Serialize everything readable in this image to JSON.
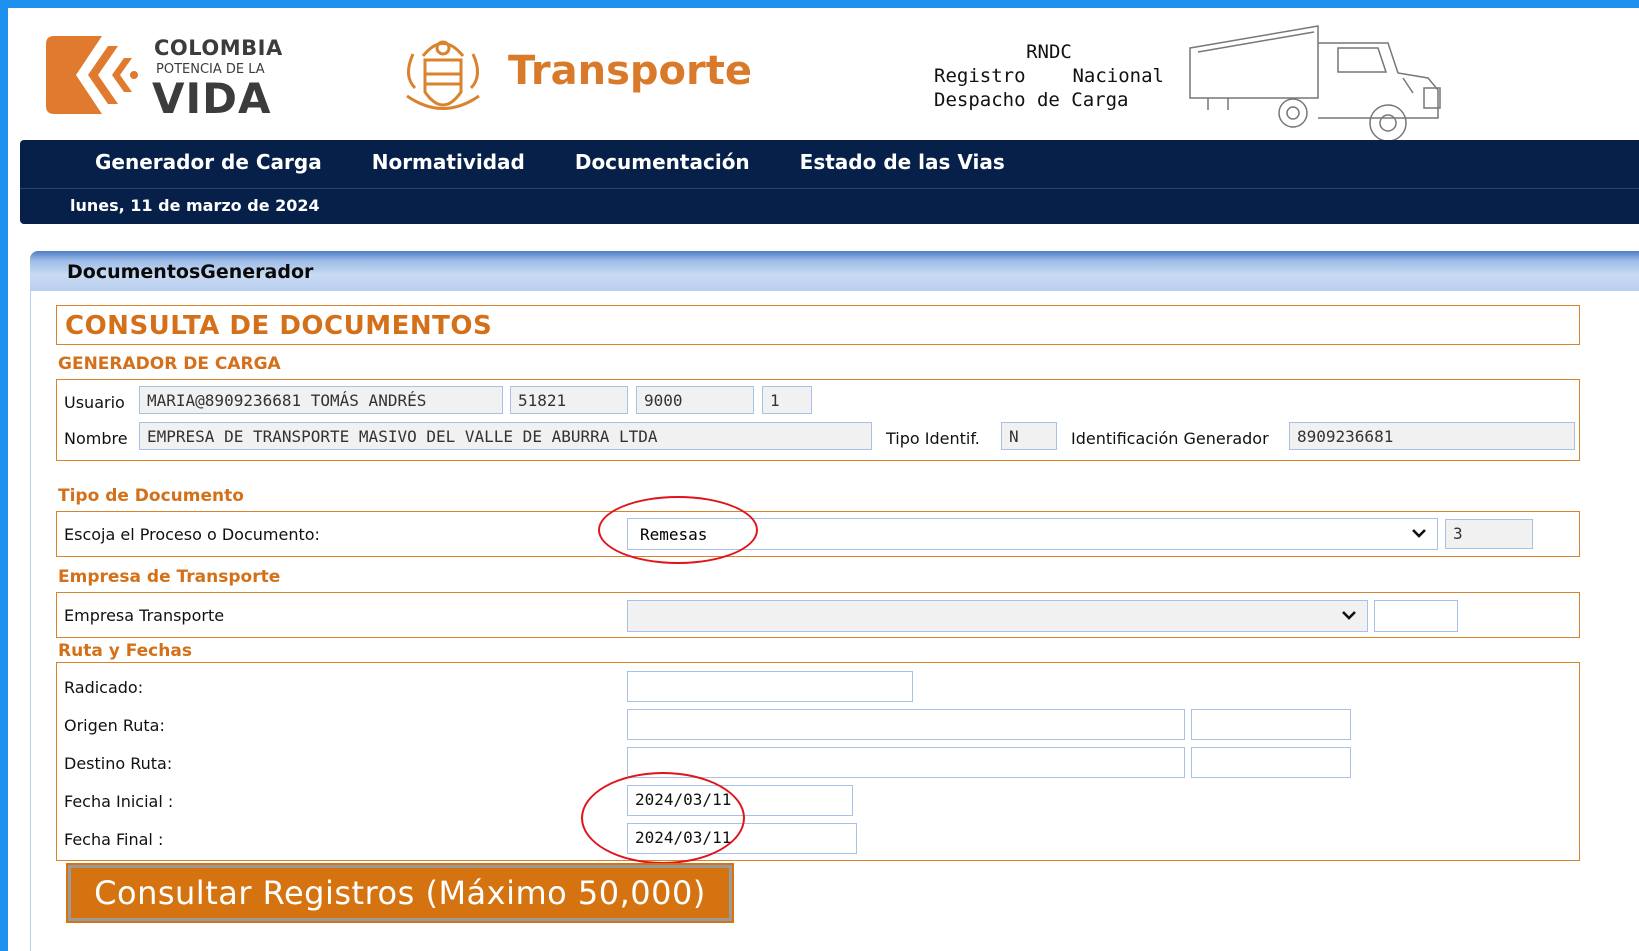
{
  "header": {
    "logo_line1": "COLOMBIA",
    "logo_line2": "POTENCIA DE LA",
    "logo_line3": "VIDA",
    "brand": "Transporte",
    "rndc_line1": "RNDC",
    "rndc_line2a": "Registro",
    "rndc_line2b": "Nacional",
    "rndc_line3": "Despacho de Carga"
  },
  "nav": {
    "items": [
      "Generador de Carga",
      "Normatividad",
      "Documentación",
      "Estado de las Vias"
    ],
    "date": "lunes, 11 de marzo de 2024"
  },
  "panel": {
    "title": "DocumentosGenerador",
    "heading": "CONSULTA DE DOCUMENTOS"
  },
  "generador": {
    "section": "GENERADOR DE CARGA",
    "usuario_label": "Usuario",
    "usuario_value": "MARIA@8909236681 TOMÁS ANDRÉS",
    "field2": "51821",
    "field3": "9000",
    "field4": "1",
    "nombre_label": "Nombre",
    "nombre_value": "EMPRESA DE TRANSPORTE MASIVO DEL VALLE DE ABURRA LTDA",
    "tipo_label": "Tipo Identif.",
    "tipo_value": "N",
    "ident_label": "Identificación Generador",
    "ident_value": "8909236681"
  },
  "tipo_documento": {
    "section": "Tipo de Documento",
    "label": "Escoja el Proceso o Documento:",
    "selected": "Remesas",
    "code": "3"
  },
  "empresa": {
    "section": "Empresa de Transporte",
    "label": "Empresa Transporte",
    "selected": "",
    "code": ""
  },
  "ruta": {
    "section": "Ruta y Fechas",
    "radicado_label": "Radicado:",
    "origen_label": "Origen Ruta:",
    "destino_label": "Destino Ruta:",
    "fecha_inicial_label": "Fecha Inicial :",
    "fecha_inicial": "2024/03/11",
    "fecha_final_label": "Fecha Final :",
    "fecha_final": "2024/03/11"
  },
  "button": "Consultar Registros (Máximo 50,000)",
  "colors": {
    "accent": "#d4701a",
    "nav_bg": "#06204a",
    "frame": "#1e90ef",
    "annotation": "#e0141b"
  }
}
